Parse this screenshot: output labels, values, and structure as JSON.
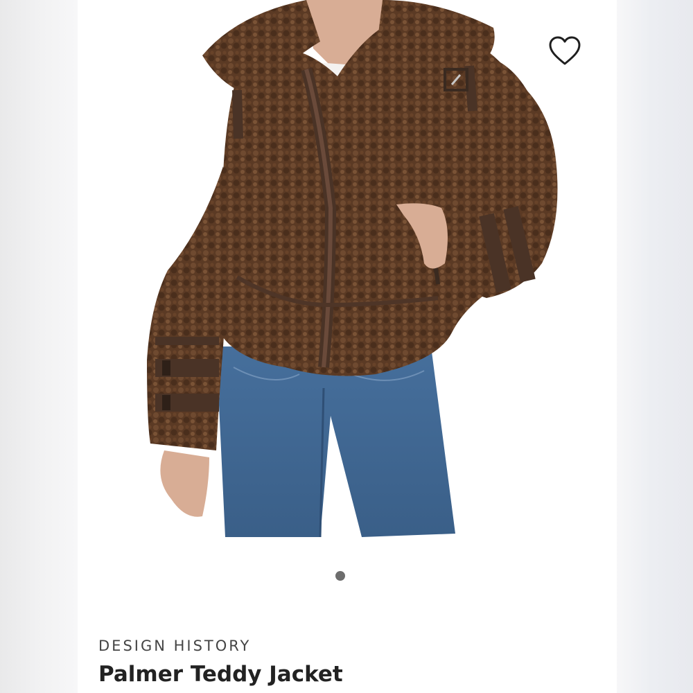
{
  "product": {
    "brand": "DESIGN HISTORY",
    "title": "Palmer Teddy Jacket",
    "image": {
      "subject": "product-photo"
    }
  },
  "favorite": {
    "icon": "heart-icon",
    "selected": false
  },
  "carousel": {
    "dot_count": 1,
    "active_index": 0
  },
  "colors": {
    "card_background": "#ffffff",
    "page_background": "#f5f5f6",
    "brand_text": "#444444",
    "title_text": "#222222",
    "dot": "#6d6d6d",
    "jacket": "#5a3a24",
    "denim": "#3e6490"
  }
}
